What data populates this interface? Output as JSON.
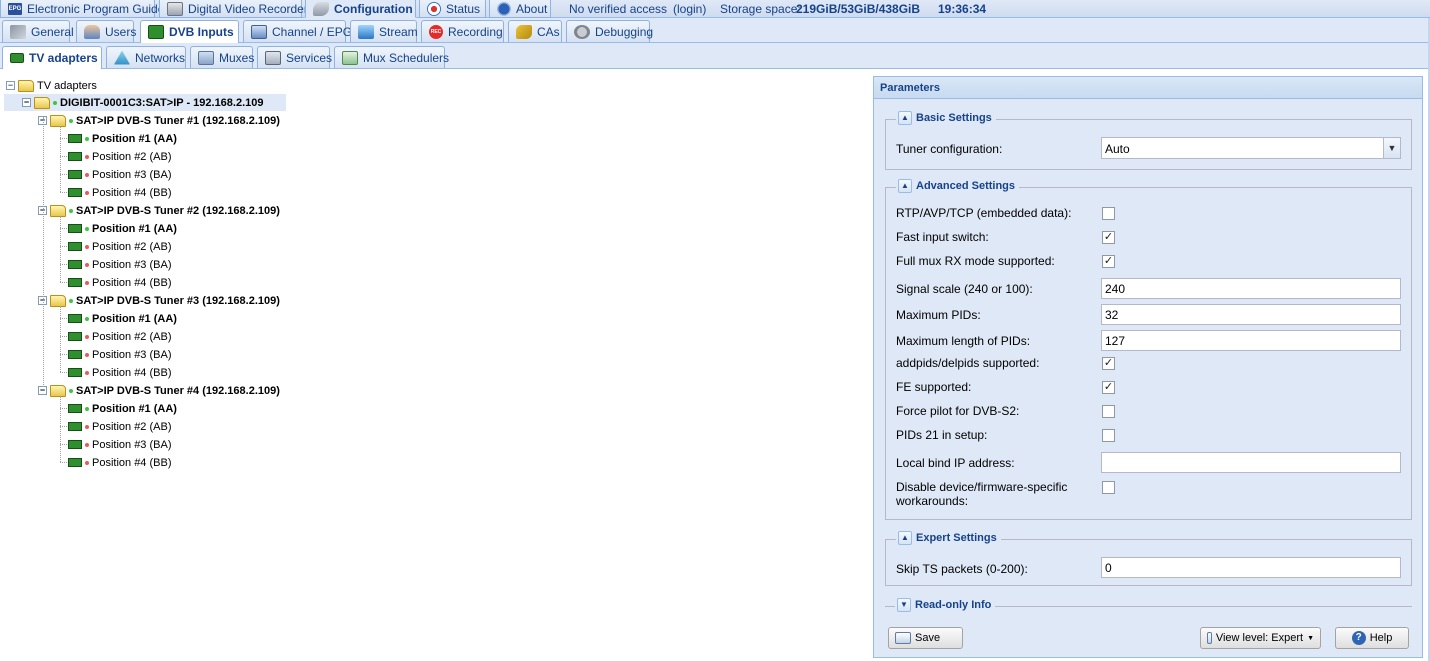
{
  "top_tabs": [
    {
      "label": "Electronic Program Guide",
      "icon": "epg-icon"
    },
    {
      "label": "Digital Video Recorder",
      "icon": "dvr-icon"
    },
    {
      "label": "Configuration",
      "icon": "wrench-icon"
    },
    {
      "label": "Status",
      "icon": "status-icon"
    },
    {
      "label": "About",
      "icon": "info-icon"
    }
  ],
  "top_icon_text": {
    "epg": "EPG",
    "rec": "REC"
  },
  "top_status": {
    "access": "No verified access",
    "login": "(login)",
    "storage_label": "Storage space:",
    "storage_value": "219GiB/53GiB/438GiB",
    "time": "19:36:34"
  },
  "config_tabs": [
    {
      "label": "General"
    },
    {
      "label": "Users"
    },
    {
      "label": "DVB Inputs"
    },
    {
      "label": "Channel / EPG"
    },
    {
      "label": "Stream"
    },
    {
      "label": "Recording"
    },
    {
      "label": "CAs"
    },
    {
      "label": "Debugging"
    }
  ],
  "dvb_tabs": [
    {
      "label": "TV adapters"
    },
    {
      "label": "Networks"
    },
    {
      "label": "Muxes"
    },
    {
      "label": "Services"
    },
    {
      "label": "Mux Schedulers"
    }
  ],
  "tree": {
    "root": "TV adapters",
    "device": "DIGIBIT-0001C3:SAT>IP - 192.168.2.109",
    "tuners": [
      {
        "label": "SAT>IP DVB-S Tuner #1 (192.168.2.109)",
        "positions": [
          "Position #1 (AA)",
          "Position #2 (AB)",
          "Position #3 (BA)",
          "Position #4 (BB)"
        ]
      },
      {
        "label": "SAT>IP DVB-S Tuner #2 (192.168.2.109)",
        "positions": [
          "Position #1 (AA)",
          "Position #2 (AB)",
          "Position #3 (BA)",
          "Position #4 (BB)"
        ]
      },
      {
        "label": "SAT>IP DVB-S Tuner #3 (192.168.2.109)",
        "positions": [
          "Position #1 (AA)",
          "Position #2 (AB)",
          "Position #3 (BA)",
          "Position #4 (BB)"
        ]
      },
      {
        "label": "SAT>IP DVB-S Tuner #4 (192.168.2.109)",
        "positions": [
          "Position #1 (AA)",
          "Position #2 (AB)",
          "Position #3 (BA)",
          "Position #4 (BB)"
        ]
      }
    ]
  },
  "params": {
    "title": "Parameters",
    "basic": {
      "legend": "Basic Settings",
      "tuner_config_label": "Tuner configuration:",
      "tuner_config_value": "Auto"
    },
    "advanced": {
      "legend": "Advanced Settings",
      "fields": [
        {
          "label": "RTP/AVP/TCP (embedded data):",
          "type": "check",
          "checked": false
        },
        {
          "label": "Fast input switch:",
          "type": "check",
          "checked": true
        },
        {
          "label": "Full mux RX mode supported:",
          "type": "check",
          "checked": true
        },
        {
          "label": "Signal scale (240 or 100):",
          "type": "text",
          "value": "240"
        },
        {
          "label": "Maximum PIDs:",
          "type": "text",
          "value": "32"
        },
        {
          "label": "Maximum length of PIDs:",
          "type": "text",
          "value": "127"
        },
        {
          "label": "addpids/delpids supported:",
          "type": "check",
          "checked": true
        },
        {
          "label": "FE supported:",
          "type": "check",
          "checked": true
        },
        {
          "label": "Force pilot for DVB-S2:",
          "type": "check",
          "checked": false
        },
        {
          "label": "PIDs 21 in setup:",
          "type": "check",
          "checked": false
        },
        {
          "label": "Local bind IP address:",
          "type": "text",
          "value": ""
        },
        {
          "label": "Disable device/firmware-specific workarounds:",
          "type": "check",
          "checked": false
        }
      ]
    },
    "expert": {
      "legend": "Expert Settings",
      "skip_label": "Skip TS packets (0-200):",
      "skip_value": "0"
    },
    "readonly": {
      "legend": "Read-only Info"
    }
  },
  "buttons": {
    "save": "Save",
    "view_level": "View level: Expert",
    "help": "Help"
  },
  "colors": {
    "status_ok": "#3ec43e",
    "status_off": "#e85b5b",
    "accent": "#15428b",
    "panel_bg": "#dfe8f6"
  }
}
